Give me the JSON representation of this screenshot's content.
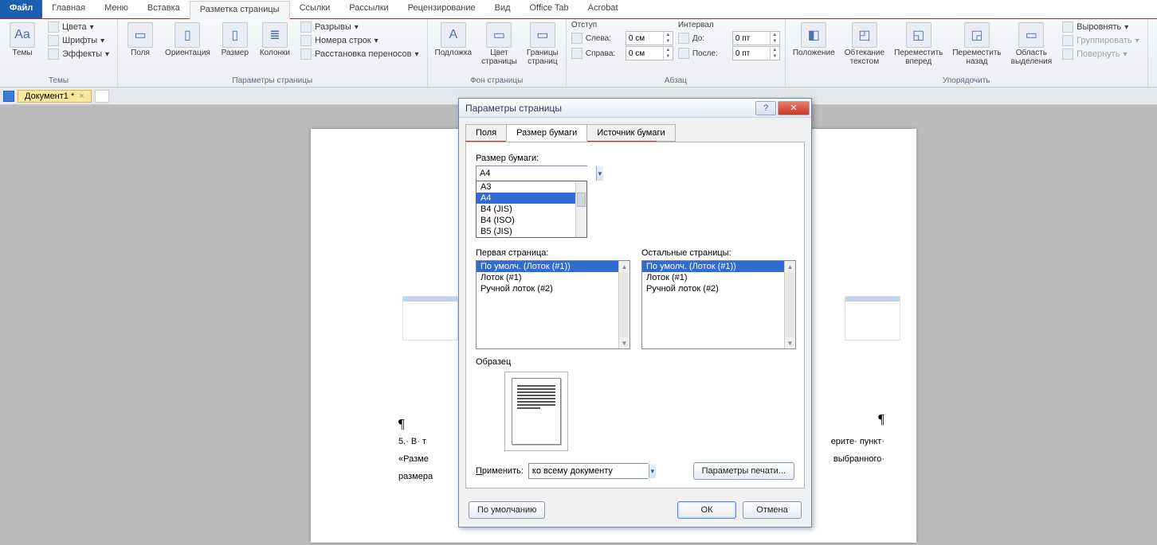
{
  "menu": {
    "file": "Файл",
    "tabs": [
      "Главная",
      "Меню",
      "Вставка",
      "Разметка страницы",
      "Ссылки",
      "Рассылки",
      "Рецензирование",
      "Вид",
      "Office Tab",
      "Acrobat"
    ],
    "active_index": 3
  },
  "ribbon": {
    "group_themes": {
      "label": "Темы",
      "themes_btn": "Темы",
      "colors": "Цвета",
      "fonts": "Шрифты",
      "effects": "Эффекты"
    },
    "group_page": {
      "label": "Параметры страницы",
      "margins": "Поля",
      "orientation": "Ориентация",
      "size": "Размер",
      "columns": "Колонки",
      "breaks": "Разрывы",
      "line_numbers": "Номера строк",
      "hyphenation": "Расстановка переносов"
    },
    "group_bg": {
      "label": "Фон страницы",
      "watermark": "Подложка",
      "page_color": "Цвет\nстраницы",
      "borders": "Границы\nстраниц"
    },
    "group_indent": {
      "title": "Отступ",
      "left": "Слева:",
      "right": "Справа:",
      "left_val": "0 см",
      "right_val": "0 см"
    },
    "group_spacing": {
      "title": "Интервал",
      "before": "До:",
      "after": "После:",
      "before_val": "0 пт",
      "after_val": "0 пт",
      "group_label": "Абзац"
    },
    "group_arrange": {
      "label": "Упорядочить",
      "position": "Положение",
      "wrap": "Обтекание\nтекстом",
      "bring_fwd": "Переместить\nвперед",
      "send_back": "Переместить\nназад",
      "selection": "Область\nвыделения",
      "align": "Выровнять",
      "group": "Группировать",
      "rotate": "Повернуть"
    }
  },
  "doc_tab": {
    "name": "Документ1 *"
  },
  "page_text": {
    "p1": "¶",
    "line1": "5.· В· т",
    "line2": "«Разме",
    "line3": "размера",
    "r1": "ерите· пункт·",
    "r2": "выбранного·",
    "pm_r": "¶"
  },
  "dialog": {
    "title": "Параметры страницы",
    "tabs": [
      "Поля",
      "Размер бумаги",
      "Источник бумаги"
    ],
    "active": 1,
    "size_label": "Размер бумаги:",
    "size_value": "A4",
    "size_options": [
      "A3",
      "A4",
      "B4 (JIS)",
      "B4 (ISO)",
      "B5 (JIS)"
    ],
    "size_selected": "A4",
    "first_label": "Первая страница:",
    "other_label": "Остальные страницы:",
    "tray_items": [
      "По умолч. (Лоток (#1))",
      "Лоток (#1)",
      "Ручной лоток (#2)"
    ],
    "preview_label": "Образец",
    "apply_label": "Применить:",
    "apply_value": "ко всему документу",
    "print_options": "Параметры печати...",
    "default_btn": "По умолчанию",
    "ok": "ОК",
    "cancel": "Отмена",
    "help": "?",
    "close": "✕"
  }
}
